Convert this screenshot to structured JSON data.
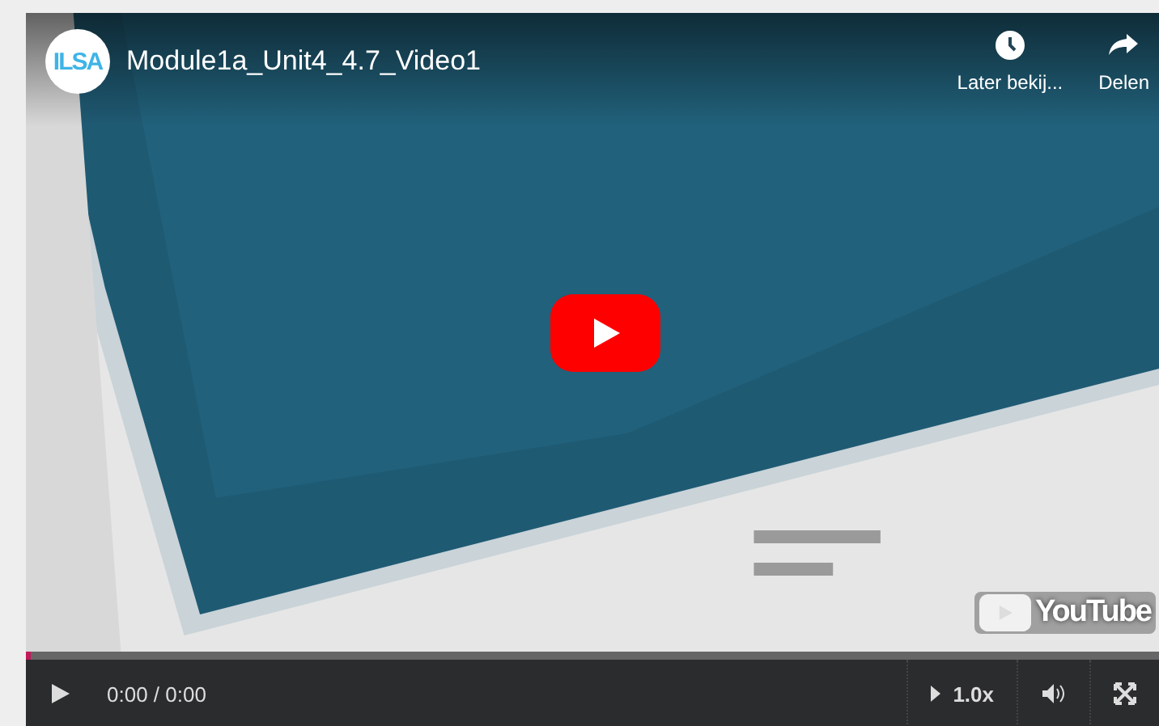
{
  "video": {
    "channel_logo": "ILSA",
    "title": "Module1a_Unit4_4.7_Video1",
    "actions": [
      {
        "kind": "clock",
        "label": "Later bekij..."
      },
      {
        "kind": "share",
        "label": "Delen"
      }
    ],
    "watermark_logo": "YouTube"
  },
  "controls": {
    "progress": {
      "level": 0
    },
    "time": "0:00 / 0:00",
    "speed": "1.0x"
  }
}
